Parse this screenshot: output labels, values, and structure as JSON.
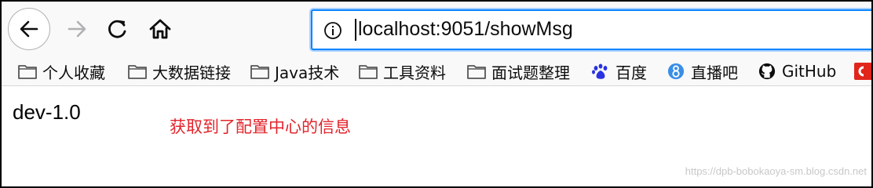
{
  "toolbar": {
    "back_icon": "back-arrow-icon",
    "forward_icon": "forward-arrow-icon",
    "reload_icon": "reload-icon",
    "home_icon": "home-icon"
  },
  "urlbar": {
    "info_icon": "info-icon",
    "url": "localhost:9051/showMsg",
    "accent_color": "#0a84ff"
  },
  "bookmarks": [
    {
      "label": "个人收藏",
      "icon": "folder-icon"
    },
    {
      "label": "大数据链接",
      "icon": "folder-icon"
    },
    {
      "label": "Java技术",
      "icon": "folder-icon"
    },
    {
      "label": "工具资料",
      "icon": "folder-icon"
    },
    {
      "label": "面试题整理",
      "icon": "folder-icon"
    },
    {
      "label": "百度",
      "icon": "baidu-paw-icon"
    },
    {
      "label": "直播吧",
      "icon": "zhibo8-icon"
    },
    {
      "label": "GitHub",
      "icon": "github-icon"
    },
    {
      "label": "",
      "icon": "red-logo-icon"
    }
  ],
  "content": {
    "text": "dev-1.0",
    "annotation": "获取到了配置中心的信息",
    "annotation_color": "#e3242b"
  },
  "watermark": "https://dpb-bobokaoya-sm.blog.csdn.net"
}
